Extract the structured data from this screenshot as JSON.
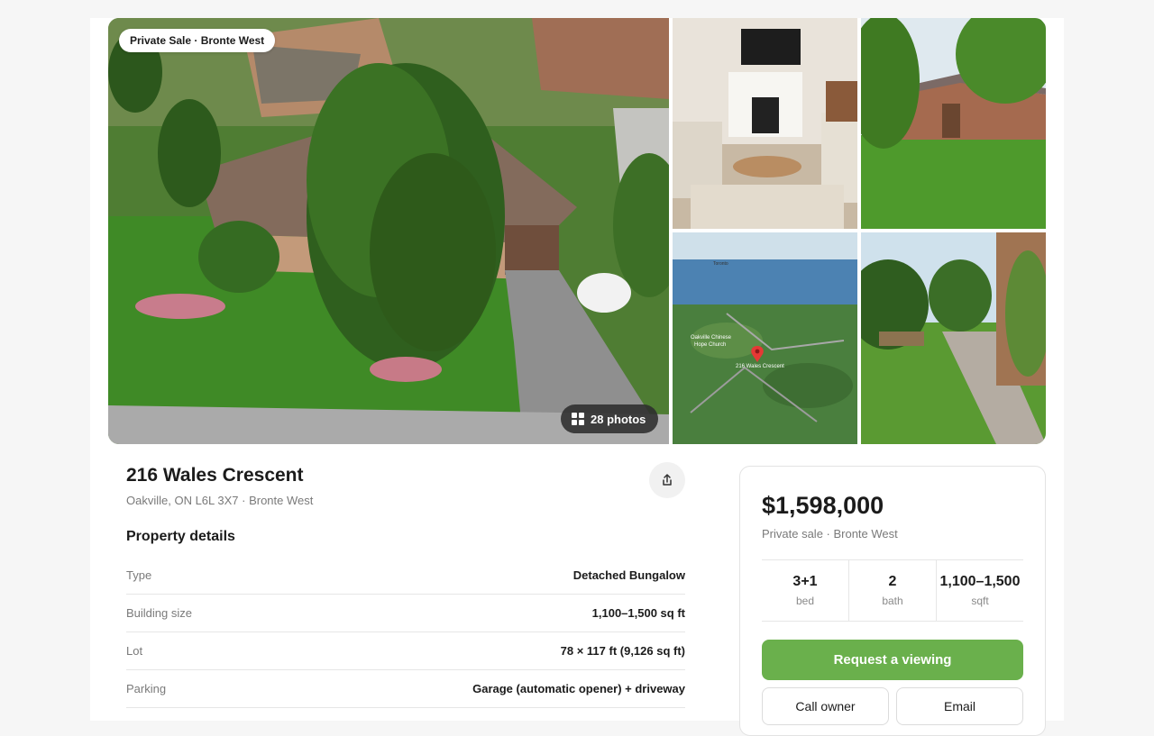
{
  "gallery": {
    "badge": "Private Sale · Bronte West",
    "photos_button": "28 photos",
    "photos": [
      {
        "name": "aerial-house-photo"
      },
      {
        "name": "living-room-photo"
      },
      {
        "name": "front-lawn-photo"
      },
      {
        "name": "map-aerial-photo",
        "map_labels": [
          "Oakville Chinese Hope Church",
          "216 Wales Crescent",
          "Toronto"
        ]
      },
      {
        "name": "backyard-photo"
      }
    ]
  },
  "listing": {
    "title": "216 Wales Crescent",
    "subtitle": "Oakville, ON L6L 3X7 · Bronte West"
  },
  "details": {
    "heading": "Property details",
    "rows": [
      {
        "label": "Type",
        "value": "Detached Bungalow"
      },
      {
        "label": "Building size",
        "value": "1,100–1,500 sq ft"
      },
      {
        "label": "Lot",
        "value": "78 × 117 ft (9,126 sq ft)"
      },
      {
        "label": "Parking",
        "value": "Garage (automatic opener) + driveway"
      }
    ]
  },
  "card": {
    "price": "$1,598,000",
    "subtitle": "Private sale · Bronte West",
    "stats": [
      {
        "value": "3+1",
        "label": "bed"
      },
      {
        "value": "2",
        "label": "bath"
      },
      {
        "value": "1,100–1,500",
        "label": "sqft"
      }
    ],
    "primary_button": "Request a viewing",
    "call_button": "Call owner",
    "email_button": "Email"
  },
  "colors": {
    "accent_green": "#6ab04c",
    "text": "#1b1b1b",
    "muted": "#7a7a7a"
  },
  "icons": {
    "share": "share-icon",
    "grid": "grid-icon",
    "map_pin": "map-pin-icon"
  }
}
